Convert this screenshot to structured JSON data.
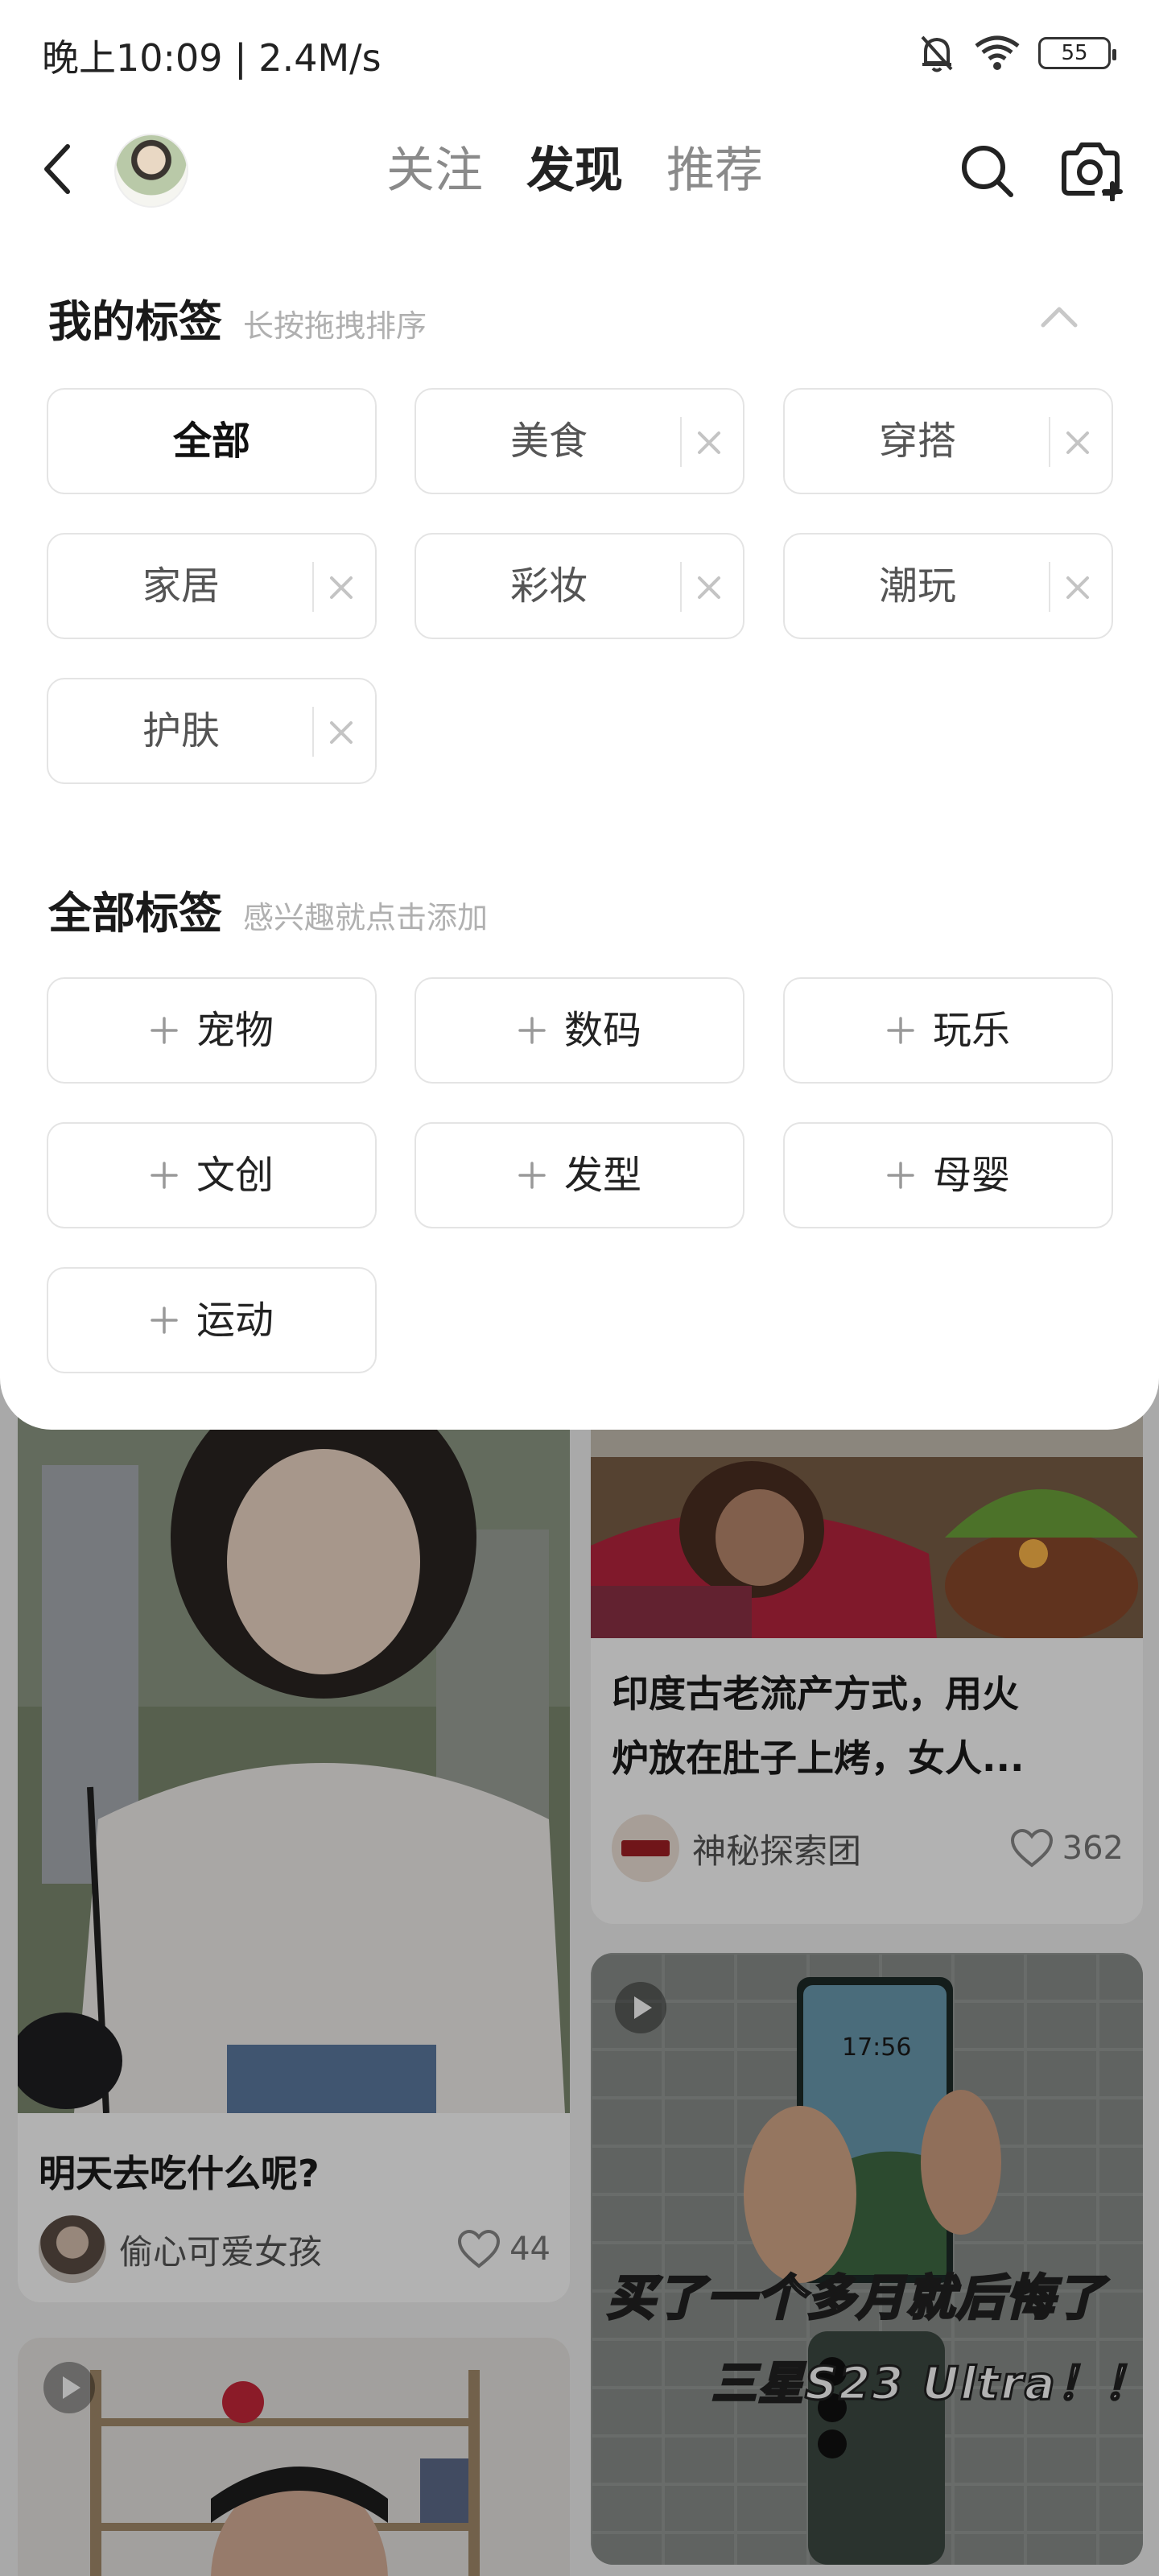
{
  "status_bar": {
    "time_speed": "晚上10:09 | 2.4M/s",
    "battery": "55"
  },
  "nav": {
    "tabs": [
      {
        "label": "关注",
        "active": false
      },
      {
        "label": "发现",
        "active": true
      },
      {
        "label": "推荐",
        "active": false
      }
    ]
  },
  "my_tags": {
    "title": "我的标签",
    "hint": "长按拖拽排序",
    "items": [
      "全部",
      "美食",
      "穿搭",
      "家居",
      "彩妆",
      "潮玩",
      "护肤"
    ]
  },
  "all_tags": {
    "title": "全部标签",
    "hint": "感兴趣就点击添加",
    "items": [
      "宠物",
      "数码",
      "玩乐",
      "文创",
      "发型",
      "母婴",
      "运动"
    ]
  },
  "feed": {
    "cards": [
      {
        "title": "明天去吃什么呢?",
        "author": "偷心可爱女孩",
        "likes": "44"
      },
      {
        "title_line1": "印度古老流产方式，用火",
        "title_line2": "炉放在肚子上烤，女人...",
        "author": "神秘探索团",
        "likes": "362"
      },
      {
        "overlay_line1": "买了一个多月就后悔了",
        "overlay_line2": "三星S23 Ultra！！",
        "phone_time": "17:56"
      }
    ]
  },
  "colors": {
    "accent_text": "#222222",
    "muted_text": "#8a8a8a",
    "chip_border": "#e4e4e4"
  }
}
